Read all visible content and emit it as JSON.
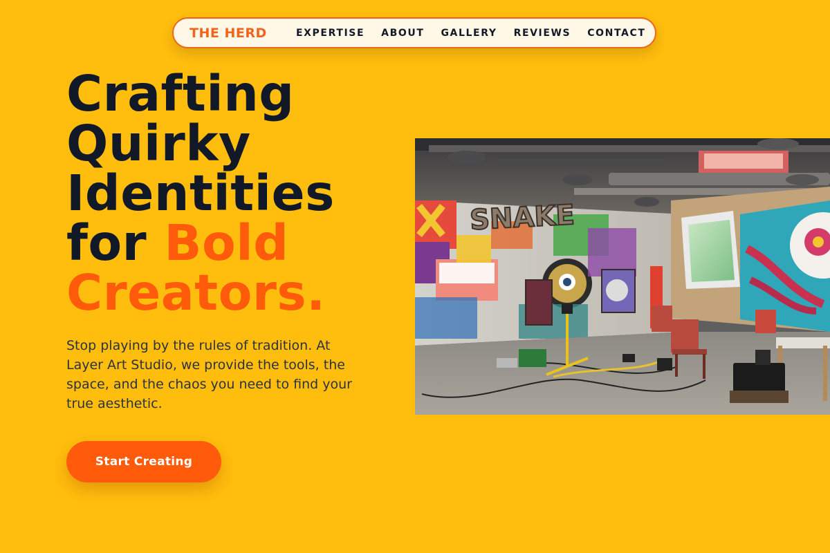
{
  "nav": {
    "brand": "THE HERD",
    "links": [
      "EXPERTISE",
      "ABOUT",
      "GALLERY",
      "REVIEWS",
      "CONTACT"
    ]
  },
  "hero": {
    "headline_lines": [
      "Crafting",
      "Quirky",
      "Identities",
      "for"
    ],
    "headline_accent_inline": "Bold",
    "headline_accent_last": "Creators.",
    "subtext": "Stop playing by the rules of tradition. At Layer Art Studio, we provide the tools, the space, and the chaos you need to find your true aesthetic.",
    "cta_label": "Start Creating"
  },
  "image": {
    "graffiti_text": "SNAKE"
  },
  "colors": {
    "background": "#FFBD0D",
    "accent": "#FF5B0B",
    "brand": "#F0641E",
    "text_dark": "#111827",
    "nav_bg": "#FFF8E6"
  }
}
